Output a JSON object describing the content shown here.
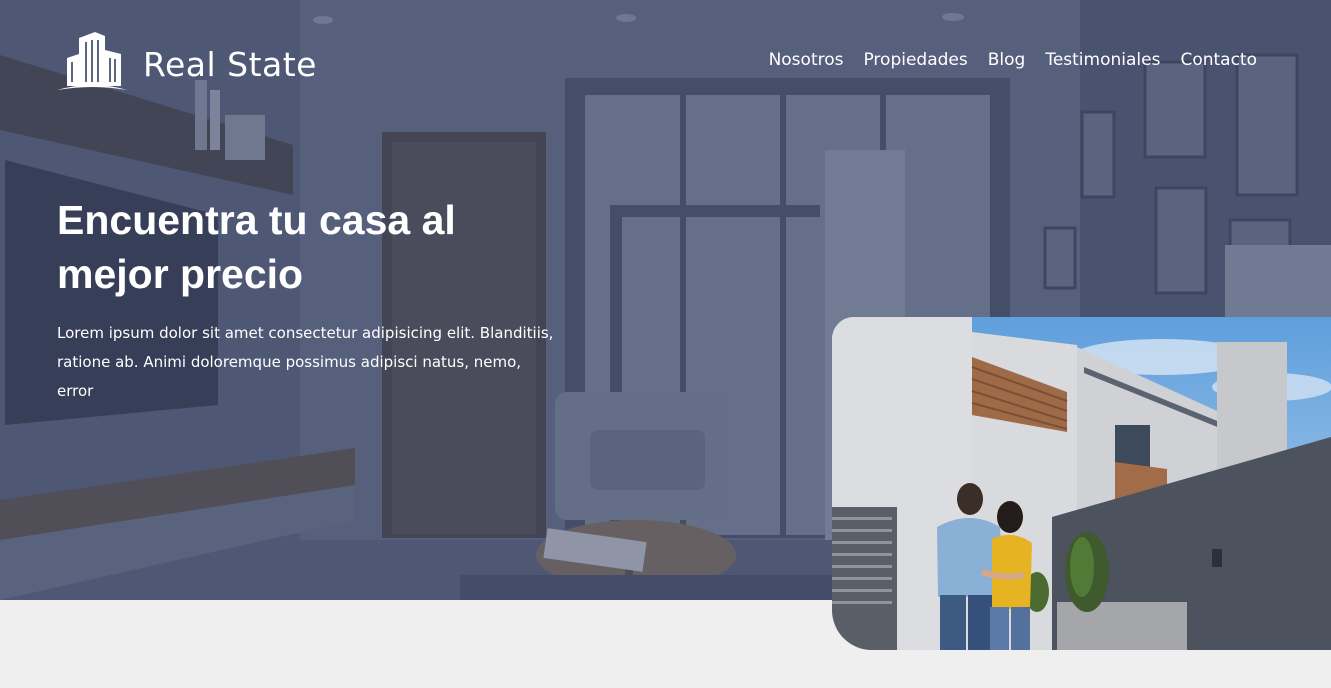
{
  "brand": {
    "name": "Real State",
    "logo_icon": "buildings-icon"
  },
  "nav": {
    "items": [
      {
        "label": "Nosotros"
      },
      {
        "label": "Propiedades"
      },
      {
        "label": "Blog"
      },
      {
        "label": "Testimoniales"
      },
      {
        "label": "Contacto"
      }
    ]
  },
  "hero": {
    "title": "Encuentra tu casa al mejor precio",
    "description": "Lorem ipsum dolor sit amet consectetur adipisicing elit. Blanditiis, ratione ab. Animi doloremque possimus adipisci natus, nemo, error",
    "background": "interior-living-room-photo",
    "photo": "couple-in-front-of-modern-house-photo"
  },
  "colors": {
    "overlay": "#3a4570",
    "text": "#ffffff",
    "page_background": "#efefef"
  }
}
